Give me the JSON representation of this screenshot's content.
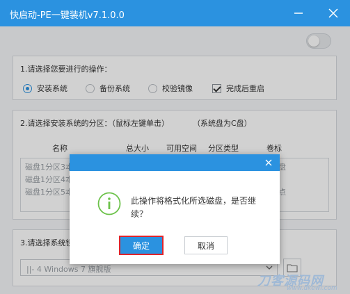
{
  "app": {
    "title": "快启动-PE一键装机v7.1.0.0"
  },
  "section1": {
    "title": "1.请选择您要进行的操作：",
    "options": [
      {
        "label": "安装系统",
        "selected": true
      },
      {
        "label": "备份系统",
        "selected": false
      },
      {
        "label": "校验镜像",
        "selected": false
      }
    ],
    "restart": {
      "label": "完成后重启",
      "checked": true
    }
  },
  "section2": {
    "title": "2.请选择安装系统的分区：（鼠标左键单击）",
    "hint": "（系统盘为C盘）",
    "columns": [
      "名称",
      "总大小",
      "可用空间",
      "分区类型",
      "卷标"
    ],
    "rows": [
      {
        "name": "磁盘1分区3本",
        "label": "盘"
      },
      {
        "name": "磁盘1分区4本",
        "label": ""
      },
      {
        "name": "磁盘1分区5本",
        "label": "点"
      }
    ]
  },
  "section3": {
    "title": "3.请选择系统镜",
    "image_value": "||- 4 Windows  7 旗舰版"
  },
  "dialog": {
    "message": "此操作将格式化所选磁盘，是否继续？",
    "ok_label": "确定",
    "cancel_label": "取消"
  },
  "watermark": {
    "brand": "刀客源码网",
    "url": "www.dkewl.com"
  },
  "colors": {
    "accent": "#2b92e0",
    "highlight": "#e0242b",
    "info_icon": "#6cc24a"
  },
  "icons": {
    "minimize": "minimize-icon",
    "close": "close-icon",
    "dialog_close": "close-icon",
    "info": "info-circle-icon",
    "dropdown": "chevron-down-icon",
    "folder": "folder-icon"
  }
}
